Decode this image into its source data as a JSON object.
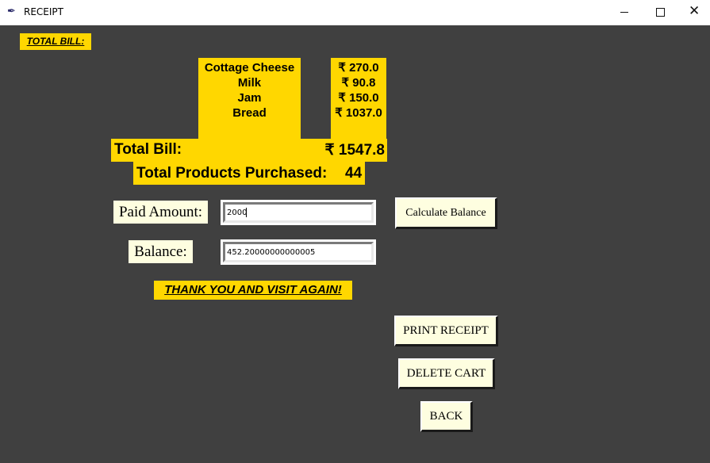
{
  "window": {
    "title": "RECEIPT",
    "icon": "feather-icon",
    "controls": {
      "minimize": "minimize-icon",
      "maximize": "maximize-icon",
      "close": "close-icon",
      "close_glyph": "✕"
    }
  },
  "heading": "TOTAL BILL:",
  "items": [
    "Cottage Cheese",
    "Milk",
    "Jam",
    "Bread"
  ],
  "prices": [
    "₹ 270.0",
    "₹ 90.8",
    "₹ 150.0",
    "₹ 1037.0"
  ],
  "total": {
    "label": "Total Bill:",
    "value": "₹ 1547.8"
  },
  "products": {
    "label": "Total Products Purchased:",
    "count": "44"
  },
  "paid": {
    "label": "Paid Amount:",
    "value": "2000"
  },
  "balance": {
    "label": "Balance:",
    "value": "452.20000000000005"
  },
  "buttons": {
    "calculate": "Calculate Balance",
    "print": "PRINT RECEIPT",
    "delete": "DELETE CART",
    "back": "BACK"
  },
  "thanks": "THANK YOU AND VISIT AGAIN!",
  "colors": {
    "background": "#404040",
    "accent": "#ffd700",
    "button": "#fefee0"
  }
}
